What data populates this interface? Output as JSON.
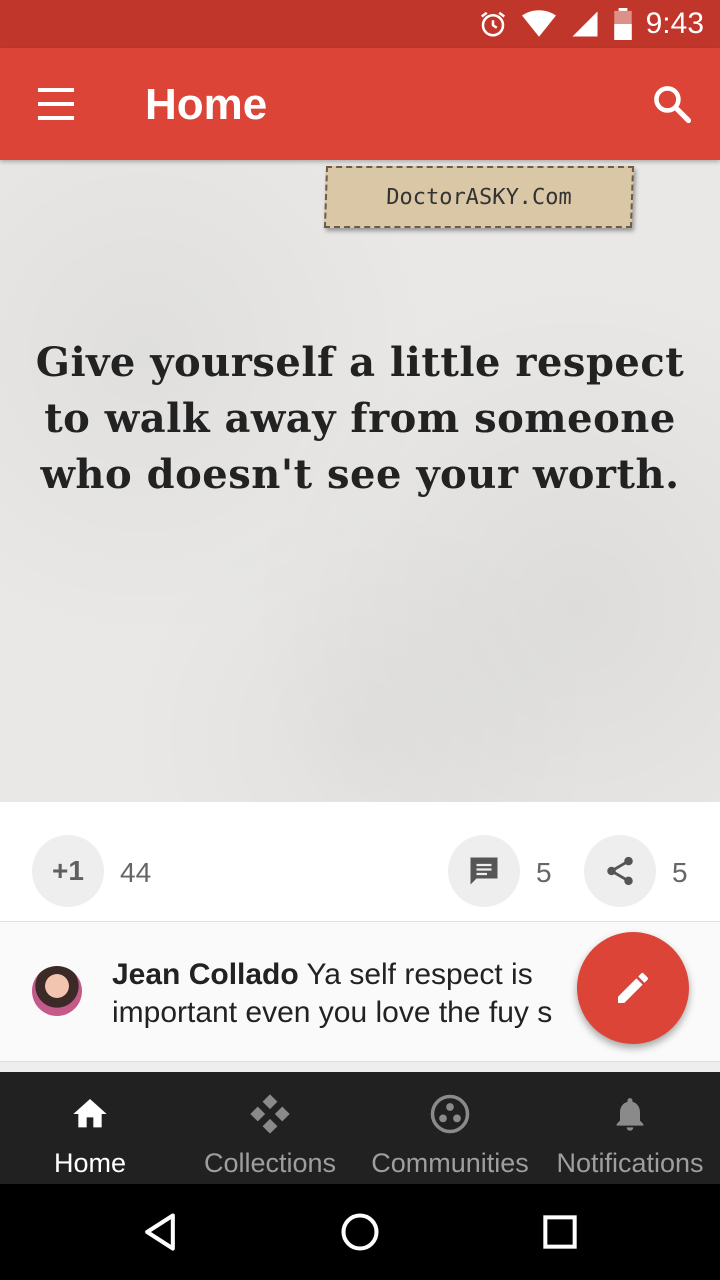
{
  "status_bar": {
    "time": "9:43",
    "icons": [
      "alarm-icon",
      "wifi-icon",
      "signal-icon",
      "battery-icon"
    ]
  },
  "app_bar": {
    "title": "Home",
    "menu_icon": "hamburger-menu-icon",
    "search_icon": "search-icon",
    "color": "#db4437"
  },
  "post": {
    "image_tag": "DoctorASKY.Com",
    "quote_lines": [
      "Give yourself a little respect",
      "to walk away from someone",
      "who doesn't see your worth."
    ],
    "plusone_label": "+1",
    "plusone_count": "44",
    "comment_count": "5",
    "share_count": "5"
  },
  "comment": {
    "author": "Jean Collado",
    "text": " Ya self respect is important even you love the fuy s"
  },
  "fab": {
    "icon": "pencil-icon",
    "color": "#db4437"
  },
  "bottom_nav": {
    "items": [
      {
        "label": "Home",
        "icon": "home-icon",
        "active": true
      },
      {
        "label": "Collections",
        "icon": "collections-icon",
        "active": false
      },
      {
        "label": "Communities",
        "icon": "communities-icon",
        "active": false
      },
      {
        "label": "Notifications",
        "icon": "bell-icon",
        "active": false
      }
    ]
  },
  "system_nav": {
    "icons": [
      "back-icon",
      "home-circle-icon",
      "recents-icon"
    ]
  }
}
